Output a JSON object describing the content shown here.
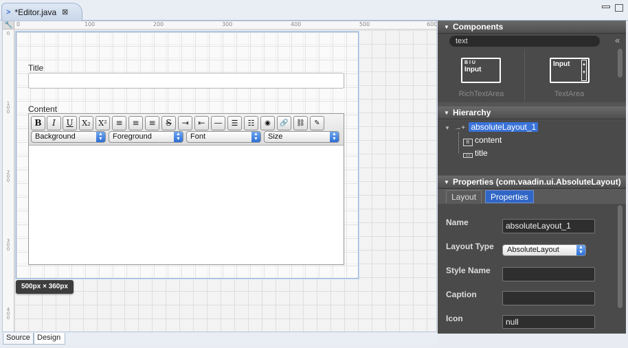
{
  "editor_tab": {
    "title": "*Editor.java",
    "close": "⊠"
  },
  "design": {
    "ruler_top": [
      "0",
      "100",
      "200",
      "300",
      "400",
      "500",
      "600"
    ],
    "ruler_left": [
      "0",
      "100",
      "200",
      "300",
      "400"
    ],
    "form": {
      "title_label": "Title",
      "content_label": "Content",
      "toolbar_buttons": [
        "B",
        "I",
        "U",
        "X₂",
        "X²",
        "≡",
        "≡",
        "≡",
        "S",
        "⇥",
        "⇤",
        "—",
        "☰",
        "☷",
        "◉",
        "🔗",
        "⛓",
        "✎"
      ],
      "selects": [
        "Background",
        "Foreground",
        "Font",
        "Size"
      ]
    },
    "size_tooltip": "500px × 360px"
  },
  "bottom_tabs": {
    "source": "Source",
    "design": "Design"
  },
  "components": {
    "header": "Components",
    "search_value": "text",
    "items": [
      {
        "name": "RichTextArea",
        "preview_format": "B I U",
        "preview_text": "Input"
      },
      {
        "name": "TextArea",
        "preview_text": "Input"
      }
    ]
  },
  "hierarchy": {
    "header": "Hierarchy",
    "root": "absoluteLayout_1",
    "children": [
      "content",
      "title"
    ]
  },
  "properties": {
    "header": "Properties (com.vaadin.ui.AbsoluteLayout)",
    "tabs": [
      "Layout",
      "Properties"
    ],
    "fields": {
      "name_label": "Name",
      "name_value": "absoluteLayout_1",
      "layout_type_label": "Layout Type",
      "layout_type_value": "AbsoluteLayout",
      "style_name_label": "Style Name",
      "style_name_value": "",
      "caption_label": "Caption",
      "caption_value": "",
      "icon_label": "Icon",
      "icon_value": "null"
    }
  },
  "colors": {
    "selection": "#3a73d8",
    "panel_bg": "#4a4a4a",
    "header_bg": "#5a5a5a"
  }
}
